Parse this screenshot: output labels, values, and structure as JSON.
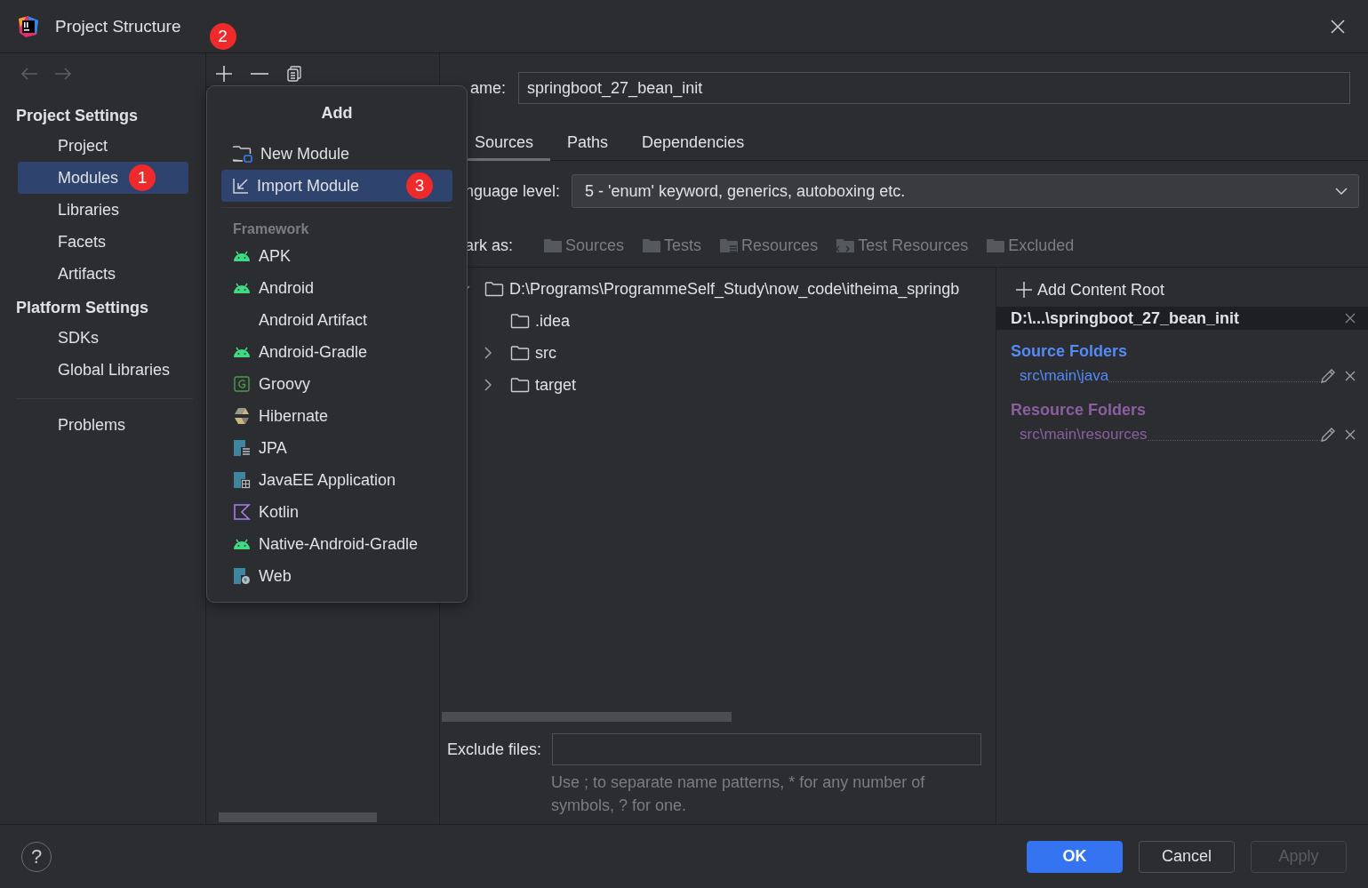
{
  "window": {
    "title": "Project Structure",
    "badge": "2"
  },
  "sidebar": {
    "sections": [
      {
        "heading": "Project Settings",
        "items": [
          {
            "label": "Project",
            "selected": false
          },
          {
            "label": "Modules",
            "selected": true,
            "badge": "1"
          },
          {
            "label": "Libraries",
            "selected": false
          },
          {
            "label": "Facets",
            "selected": false
          },
          {
            "label": "Artifacts",
            "selected": false
          }
        ]
      },
      {
        "heading": "Platform Settings",
        "items": [
          {
            "label": "SDKs",
            "selected": false
          },
          {
            "label": "Global Libraries",
            "selected": false
          }
        ]
      }
    ],
    "bottom_items": [
      {
        "label": "Problems",
        "selected": false
      }
    ]
  },
  "add_menu": {
    "title": "Add",
    "items": [
      {
        "label": "New Module",
        "kind": "new",
        "selected": false
      },
      {
        "label": "Import Module",
        "kind": "import",
        "selected": true,
        "badge": "3"
      }
    ],
    "framework_heading": "Framework",
    "frameworks": [
      {
        "label": "APK",
        "kind": "android"
      },
      {
        "label": "Android",
        "kind": "android"
      },
      {
        "label": "Android Artifact",
        "kind": "none"
      },
      {
        "label": "Android-Gradle",
        "kind": "android"
      },
      {
        "label": "Groovy",
        "kind": "groovy"
      },
      {
        "label": "Hibernate",
        "kind": "hibernate"
      },
      {
        "label": "JPA",
        "kind": "jpa"
      },
      {
        "label": "JavaEE Application",
        "kind": "javaee"
      },
      {
        "label": "Kotlin",
        "kind": "kotlin"
      },
      {
        "label": "Native-Android-Gradle",
        "kind": "android"
      },
      {
        "label": "Web",
        "kind": "web"
      }
    ]
  },
  "module": {
    "name_label": "ame:",
    "name_value": "springboot_27_bean_init",
    "tabs": [
      {
        "label": "Sources",
        "selected": true
      },
      {
        "label": "Paths",
        "selected": false
      },
      {
        "label": "Dependencies",
        "selected": false
      }
    ],
    "language_label": "nguage level:",
    "language_value": "5 - 'enum' keyword, generics, autoboxing etc.",
    "mark_label": "ark as:",
    "mark_buttons": [
      {
        "label": "Sources",
        "kind": "sources"
      },
      {
        "label": "Tests",
        "kind": "tests"
      },
      {
        "label": "Resources",
        "kind": "resources"
      },
      {
        "label": "Test Resources",
        "kind": "test-resources"
      },
      {
        "label": "Excluded",
        "kind": "excluded"
      }
    ]
  },
  "tree": {
    "label": "D:\\Programs\\ProgrammeSelf_Study\\now_code\\itheima_springb",
    "expanded": true,
    "children": [
      {
        "label": ".idea",
        "expandable": false
      },
      {
        "label": "src",
        "expandable": true
      },
      {
        "label": "target",
        "expandable": true
      }
    ]
  },
  "content_roots": {
    "add_label": "Add Content Root",
    "root": "D:\\...\\springboot_27_bean_init",
    "groups": [
      {
        "heading": "Source Folders",
        "color": "#548af7",
        "folders": [
          "src\\main\\java"
        ]
      },
      {
        "heading": "Resource Folders",
        "color": "#8a5fa0",
        "folders": [
          "src\\main\\resources"
        ]
      }
    ]
  },
  "exclude": {
    "label": "Exclude files:",
    "hint": "Use ; to separate name patterns, * for any number of symbols, ? for one."
  },
  "help": "?",
  "buttons": [
    {
      "label": "OK",
      "kind": "primary",
      "disabled": false
    },
    {
      "label": "Cancel",
      "kind": "normal",
      "disabled": false
    },
    {
      "label": "Apply",
      "kind": "normal",
      "disabled": true
    }
  ]
}
